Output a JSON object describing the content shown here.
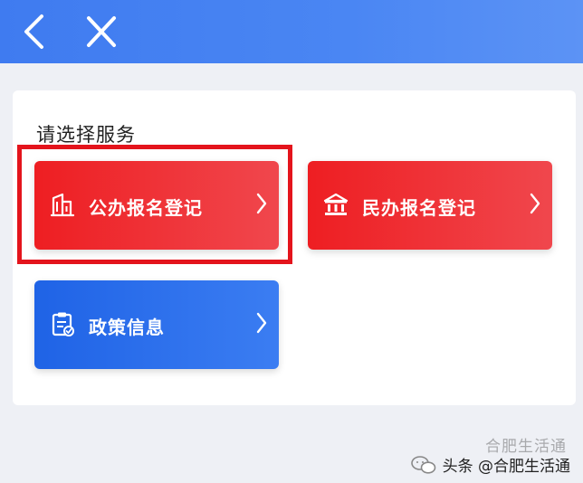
{
  "header": {
    "back_icon": "chevron-left-icon",
    "close_icon": "close-icon"
  },
  "section_title": "请选择服务",
  "services": [
    {
      "label": "公办报名登记",
      "icon": "building-icon",
      "color": "#ee1e22"
    },
    {
      "label": "民办报名登记",
      "icon": "bank-icon",
      "color": "#ee1e22"
    },
    {
      "label": "政策信息",
      "icon": "clipboard-icon",
      "color": "#1f63e6"
    }
  ],
  "watermark": {
    "text": "头条 @合肥生活通",
    "shadow_text": "合肥生活通"
  },
  "colors": {
    "header": "#3f7bf0",
    "highlight_border": "#e4141c"
  }
}
